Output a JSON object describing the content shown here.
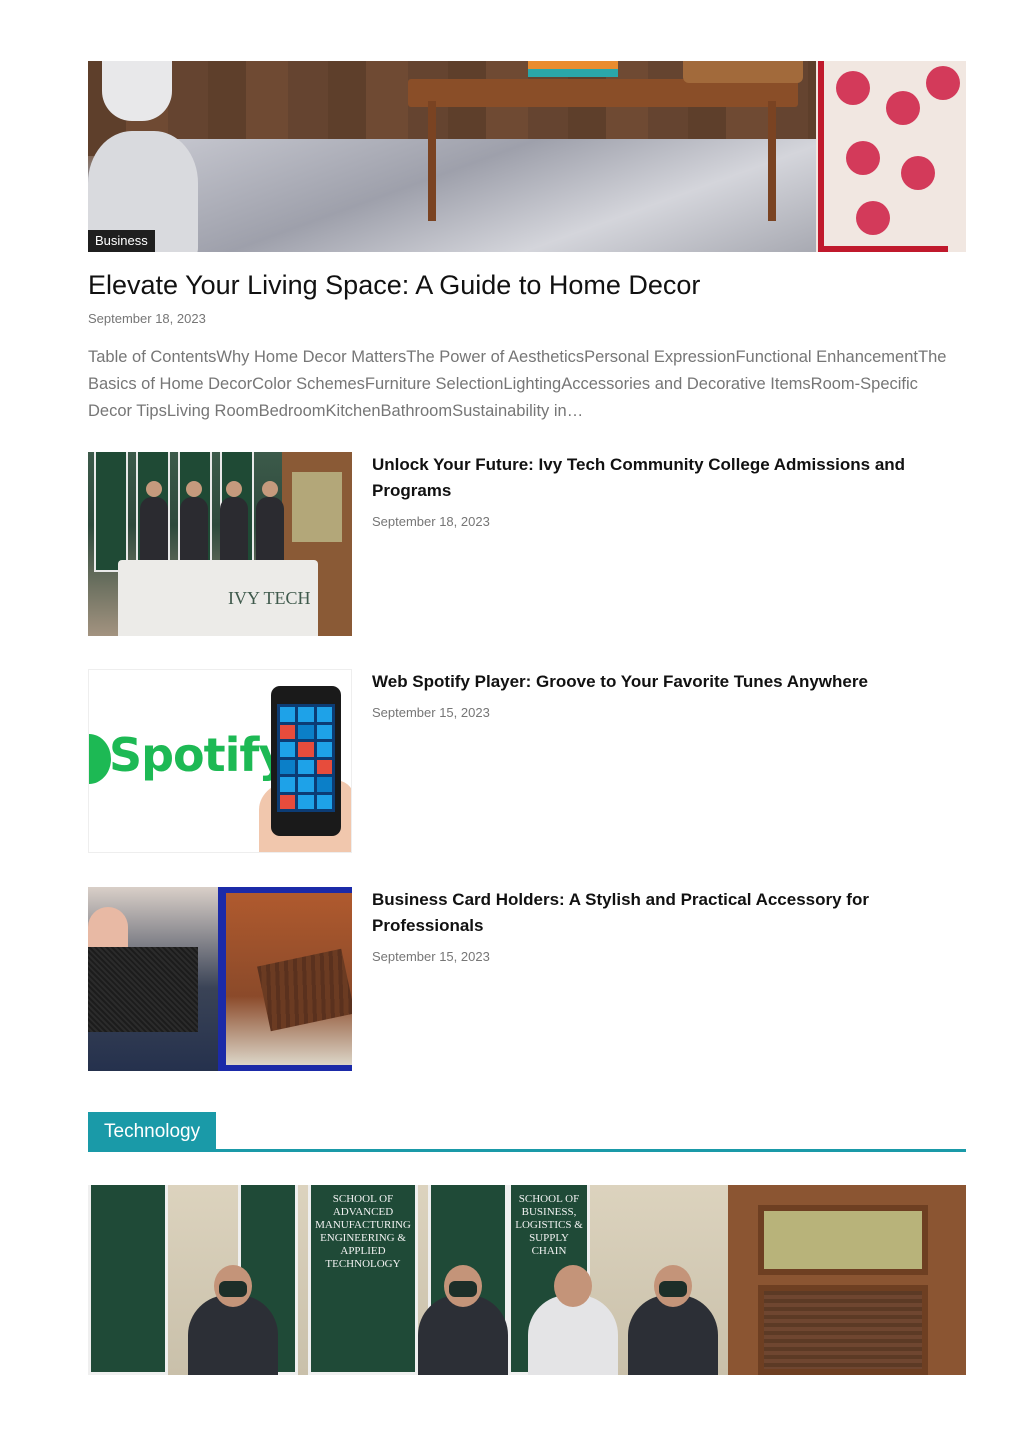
{
  "featured": {
    "category": "Business",
    "title": "Elevate Your Living Space: A Guide to Home Decor",
    "date": "September 18, 2023",
    "excerpt": "Table of ContentsWhy Home Decor MattersThe Power of AestheticsPersonal ExpressionFunctional EnhancementThe Basics of Home DecorColor SchemesFurniture SelectionLightingAccessories and Decorative ItemsRoom-Specific Decor TipsLiving RoomBedroomKitchenBathroomSustainability in…"
  },
  "posts": [
    {
      "title": "Unlock Your Future: Ivy Tech Community College Admissions and Programs",
      "date": "September 18, 2023",
      "thumb_text": "IVY TECH"
    },
    {
      "title": "Web Spotify Player: Groove to Your Favorite Tunes Anywhere",
      "date": "September 15, 2023",
      "thumb_text": "Spotify"
    },
    {
      "title": "Business Card Holders: A Stylish and Practical Accessory for Professionals",
      "date": "September 15, 2023"
    }
  ],
  "section": {
    "label": "Technology",
    "accent": "#1a9aa8",
    "banners": [
      "SCHOOL OF ADVANCED MANUFACTURING ENGINEERING & APPLIED TECHNOLOGY",
      "SCHOOL OF BUSINESS, LOGISTICS & SUPPLY CHAIN"
    ]
  }
}
